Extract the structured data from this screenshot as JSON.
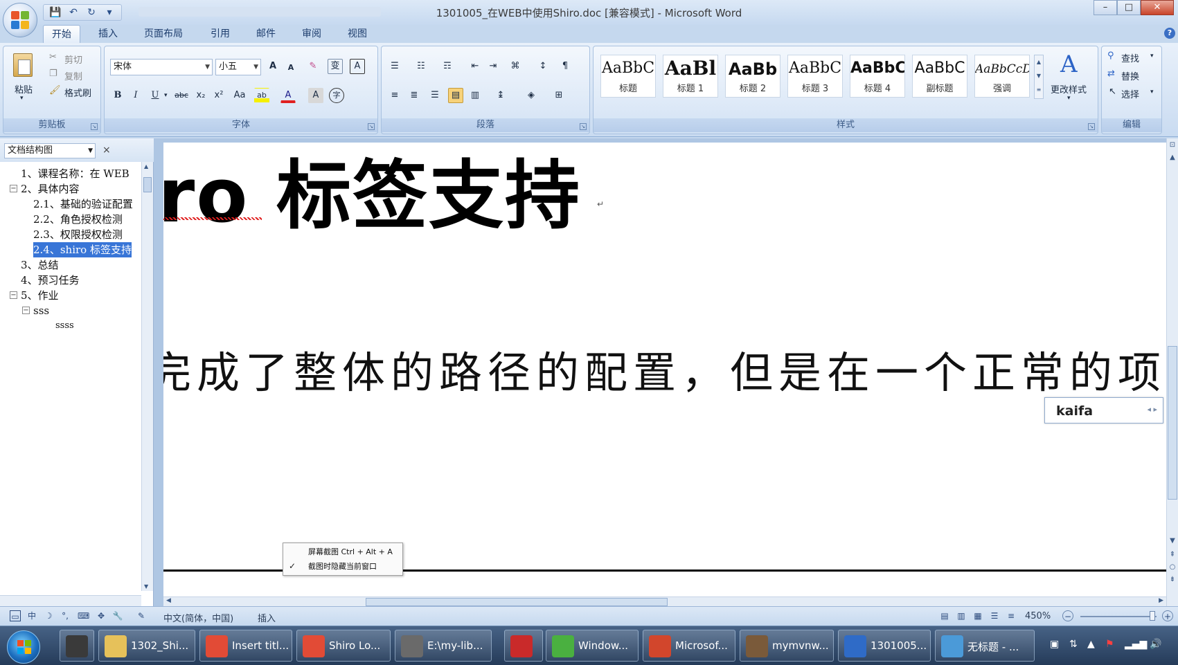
{
  "window": {
    "title": "1301005_在WEB中使用Shiro.doc [兼容模式] - Microsoft Word",
    "minimize": "–",
    "maximize": "□",
    "close": "✕"
  },
  "qat": {
    "save": "💾",
    "undo": "↶",
    "redo": "↻",
    "more": "▾"
  },
  "tabs": [
    "开始",
    "插入",
    "页面布局",
    "引用",
    "邮件",
    "审阅",
    "视图"
  ],
  "active_tab": "开始",
  "ribbon": {
    "clipboard": {
      "label": "剪贴板",
      "paste": "粘贴",
      "cut": "剪切",
      "copy": "复制",
      "format_painter": "格式刷"
    },
    "font": {
      "label": "字体",
      "font_name": "宋体",
      "font_size": "小五",
      "grow": "A",
      "shrink": "A",
      "clear": "✎",
      "phonetic": "变",
      "border_char": "A",
      "bold": "B",
      "italic": "I",
      "underline": "U",
      "strike": "abc",
      "sub": "x₂",
      "sup": "x²",
      "case": "Aa",
      "highlight": "ab",
      "font_color": "A",
      "shading": "A",
      "enclose": "字"
    },
    "paragraph": {
      "label": "段落",
      "row1": [
        "☰",
        "☷",
        "☶",
        "⇤",
        "⇥",
        "⌘",
        "↕",
        "¶"
      ],
      "row2": [
        "≡",
        "≣",
        "☰",
        "▤",
        "▥",
        "↨",
        "◈",
        "⊞"
      ]
    },
    "styles": {
      "label": "样式",
      "items": [
        {
          "sample": "AaBbC",
          "name": "标题"
        },
        {
          "sample": "AaBl",
          "name": "标题 1"
        },
        {
          "sample": "AaBb",
          "name": "标题 2"
        },
        {
          "sample": "AaBbC",
          "name": "标题 3"
        },
        {
          "sample": "AaBbC",
          "name": "标题 4"
        },
        {
          "sample": "AaBbC",
          "name": "副标题"
        },
        {
          "sample": "AaBbCcD",
          "name": "强调"
        }
      ],
      "change_styles": "更改样式"
    },
    "editing": {
      "label": "编辑",
      "find": "查找",
      "replace": "替换",
      "select": "选择"
    }
  },
  "nav": {
    "dropdown": "文档结构图",
    "close": "×",
    "items": [
      {
        "text": "1、课程名称：在 WEB",
        "level": 0,
        "toggle": ""
      },
      {
        "text": "2、具体内容",
        "level": 0,
        "toggle": "−"
      },
      {
        "text": "2.1、基础的验证配置",
        "level": 1,
        "toggle": ""
      },
      {
        "text": "2.2、角色授权检测",
        "level": 1,
        "toggle": ""
      },
      {
        "text": "2.3、权限授权检测",
        "level": 1,
        "toggle": ""
      },
      {
        "text": "2.4、shiro 标签支持",
        "level": 1,
        "toggle": "",
        "selected": true
      },
      {
        "text": "3、总结",
        "level": 0,
        "toggle": ""
      },
      {
        "text": "4、预习任务",
        "level": 0,
        "toggle": ""
      },
      {
        "text": "5、作业",
        "level": 0,
        "toggle": "−"
      },
      {
        "text": "sss",
        "level": 1,
        "toggle": "−"
      },
      {
        "text": "ssss",
        "level": 2,
        "toggle": ""
      }
    ]
  },
  "document": {
    "heading": "ro 标签支持",
    "paragraph_mark": "↵",
    "body": "完成了整体的路径的配置，但是在一个正常的项目"
  },
  "ime": {
    "text": "kaifa",
    "prev": "◂",
    "next": "▸"
  },
  "context_menu": {
    "items": [
      "屏幕截图 Ctrl + Alt + A",
      "截图时隐藏当前窗口"
    ],
    "checked_index": 1,
    "check": "✓"
  },
  "statusbar": {
    "language": "中文(简体，中国)",
    "mode": "插入",
    "zoom": "450%",
    "zoom_out": "−",
    "zoom_in": "+"
  },
  "taskbar": {
    "items": [
      {
        "label": "1302_Shi...",
        "color": "#e6c15a"
      },
      {
        "label": "Insert titl...",
        "color": "#e24b36"
      },
      {
        "label": "Shiro Lo...",
        "color": "#e24b36"
      },
      {
        "label": "E:\\my-lib...",
        "color": "#6a6a6a"
      },
      {
        "label": "Window...",
        "color": "#4ab040"
      },
      {
        "label": "Microsof...",
        "color": "#d2462c"
      },
      {
        "label": "mymvnw...",
        "color": "#7a5a3a"
      },
      {
        "label": "1301005...",
        "color": "#2f6bc7"
      },
      {
        "label": "无标题 - ...",
        "color": "#4b9ad8"
      }
    ]
  },
  "colors": {
    "accent": "#3875d7",
    "ribbon": "#d3e2f4",
    "taskbar": "#2b4468"
  }
}
